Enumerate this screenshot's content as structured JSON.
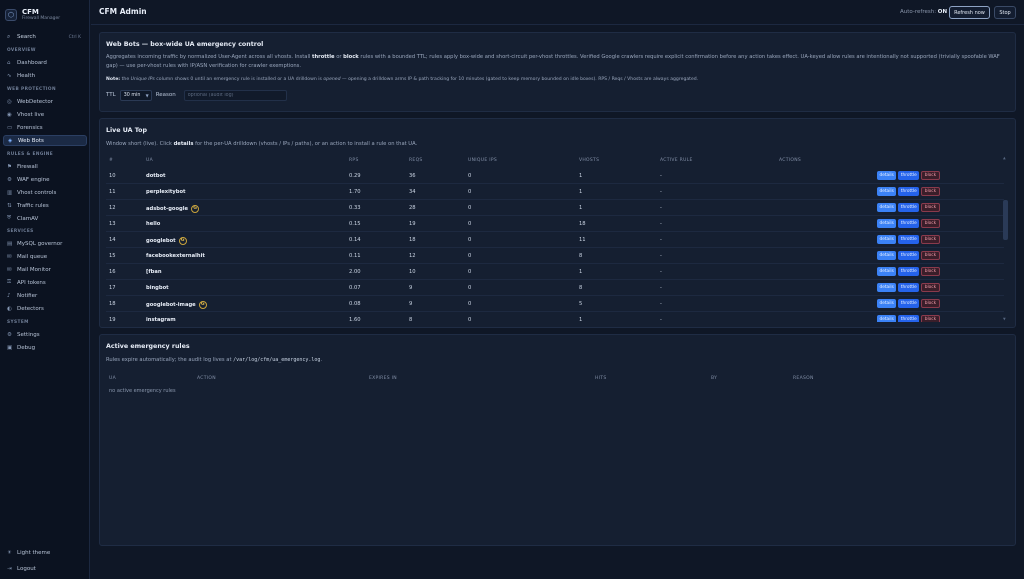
{
  "brand": {
    "logo": "⬡",
    "title": "CFM",
    "subtitle": "Firewall Manager"
  },
  "search": {
    "icon": "search-icon",
    "label": "Search",
    "shortcut": "Ctrl K"
  },
  "sidebar": {
    "sections": [
      {
        "label": "OVERVIEW",
        "items": [
          {
            "label": "Dashboard",
            "icon": "⌂"
          },
          {
            "label": "Health",
            "icon": "∿"
          }
        ]
      },
      {
        "label": "WEB PROTECTION",
        "items": [
          {
            "label": "WebDetector",
            "icon": "◎"
          },
          {
            "label": "Vhost live",
            "icon": "◉"
          },
          {
            "label": "Forensics",
            "icon": "▭"
          },
          {
            "label": "Web Bots",
            "icon": "◈"
          }
        ]
      },
      {
        "label": "RULES & ENGINE",
        "items": [
          {
            "label": "Firewall",
            "icon": "⚑"
          },
          {
            "label": "WAF engine",
            "icon": "⚙"
          },
          {
            "label": "Vhost controls",
            "icon": "▥"
          },
          {
            "label": "Traffic rules",
            "icon": "⇅"
          },
          {
            "label": "ClamAV",
            "icon": "⛨"
          }
        ]
      },
      {
        "label": "SERVICES",
        "items": [
          {
            "label": "MySQL governor",
            "icon": "▤"
          },
          {
            "label": "Mail queue",
            "icon": "✉"
          },
          {
            "label": "Mail Monitor",
            "icon": "✉"
          },
          {
            "label": "API tokens",
            "icon": "⚿"
          },
          {
            "label": "Notifier",
            "icon": "♪"
          },
          {
            "label": "Detectors",
            "icon": "◐"
          }
        ]
      },
      {
        "label": "SYSTEM",
        "items": [
          {
            "label": "Settings",
            "icon": "⚙"
          },
          {
            "label": "Debug",
            "icon": "▣"
          }
        ]
      }
    ],
    "active": "Web Bots",
    "footer": [
      {
        "label": "Light theme",
        "icon": "☀"
      },
      {
        "label": "Logout",
        "icon": "⇥"
      }
    ]
  },
  "topbar": {
    "title": "CFM Admin",
    "auto_label": "Auto-refresh:",
    "auto_value": "ON",
    "refresh_label": "Refresh now",
    "stop_label": "Stop"
  },
  "webbots": {
    "title": "Web Bots — box-wide UA emergency control",
    "ttl_label": "TTL",
    "ttl_value": "30 min",
    "reason_label": "Reason",
    "reason_placeholder": "optional (audit log)"
  },
  "live": {
    "title": "Live UA Top",
    "columns": [
      "#",
      "UA",
      "RPS",
      "REQS",
      "UNIQUE IPS",
      "VHOSTS",
      "ACTIVE RULE",
      "ACTIONS"
    ],
    "action_labels": {
      "details": "details",
      "throttle": "throttle",
      "block": "block"
    },
    "rows": [
      {
        "n": "10",
        "ua": "dotbot",
        "rps": "0.29",
        "reqs": "36",
        "ips": "0",
        "vhosts": "1",
        "rule": "-",
        "verified": false
      },
      {
        "n": "11",
        "ua": "perplexitybot",
        "rps": "1.70",
        "reqs": "34",
        "ips": "0",
        "vhosts": "1",
        "rule": "-",
        "verified": false
      },
      {
        "n": "12",
        "ua": "adsbot-google",
        "rps": "0.33",
        "reqs": "28",
        "ips": "0",
        "vhosts": "1",
        "rule": "-",
        "verified": true
      },
      {
        "n": "13",
        "ua": "hello",
        "rps": "0.15",
        "reqs": "19",
        "ips": "0",
        "vhosts": "18",
        "rule": "-",
        "verified": false
      },
      {
        "n": "14",
        "ua": "googlebot",
        "rps": "0.14",
        "reqs": "18",
        "ips": "0",
        "vhosts": "11",
        "rule": "-",
        "verified": true
      },
      {
        "n": "15",
        "ua": "facebookexternalhit",
        "rps": "0.11",
        "reqs": "12",
        "ips": "0",
        "vhosts": "8",
        "rule": "-",
        "verified": false
      },
      {
        "n": "16",
        "ua": "[fban",
        "rps": "2.00",
        "reqs": "10",
        "ips": "0",
        "vhosts": "1",
        "rule": "-",
        "verified": false
      },
      {
        "n": "17",
        "ua": "bingbot",
        "rps": "0.07",
        "reqs": "9",
        "ips": "0",
        "vhosts": "8",
        "rule": "-",
        "verified": false
      },
      {
        "n": "18",
        "ua": "googlebot-image",
        "rps": "0.08",
        "reqs": "9",
        "ips": "0",
        "vhosts": "5",
        "rule": "-",
        "verified": true
      },
      {
        "n": "19",
        "ua": "instagram",
        "rps": "1.60",
        "reqs": "8",
        "ips": "0",
        "vhosts": "1",
        "rule": "-",
        "verified": false
      }
    ],
    "verified_glyph": "G"
  },
  "emergency": {
    "title": "Active emergency rules",
    "desc_prefix": "Rules expire automatically; the audit log lives at",
    "desc_path": "/var/log/cfm/ua_emergency.log",
    "desc_suffix": ".",
    "columns": [
      "UA",
      "ACTION",
      "EXPIRES IN",
      "HITS",
      "BY",
      "REASON"
    ],
    "empty_text": "no active emergency rules"
  }
}
